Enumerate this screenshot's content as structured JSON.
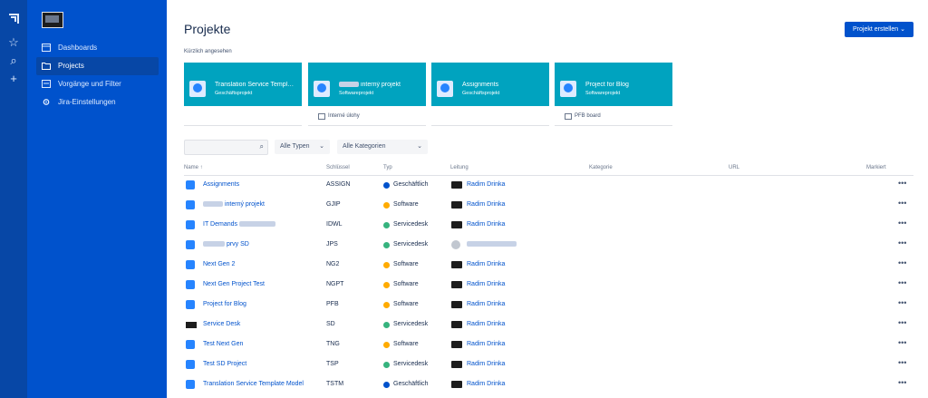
{
  "global_nav": {
    "icons": [
      "jira-logo-icon",
      "star-icon",
      "search-icon",
      "plus-icon"
    ]
  },
  "sidebar": {
    "items": [
      {
        "label": "Dashboards",
        "icon": "dashboard-icon"
      },
      {
        "label": "Projects",
        "icon": "folder-icon",
        "active": true
      },
      {
        "label": "Vorgänge und Filter",
        "icon": "issues-icon"
      },
      {
        "label": "Jira-Einstellungen",
        "icon": "gear-icon"
      }
    ]
  },
  "header": {
    "title": "Projekte",
    "create_button": "Projekt erstellen ⌄"
  },
  "recent": {
    "label": "Kürzlich angesehen",
    "cards": [
      {
        "title": "Translation Service Template Model",
        "subtitle": "Geschäftsprojekt",
        "bottom": ""
      },
      {
        "title": "interný projekt",
        "subtitle": "Softwareprojekt",
        "bottom": "Interné úlohy"
      },
      {
        "title": "Assignments",
        "subtitle": "Geschäftsprojekt",
        "bottom": ""
      },
      {
        "title": "Project for Blog",
        "subtitle": "Softwareprojekt",
        "bottom": "PFB board"
      }
    ]
  },
  "filters": {
    "search_placeholder": "",
    "types": "Alle Typen",
    "categories": "Alle Kategorien"
  },
  "table": {
    "headers": {
      "name": "Name ↑",
      "key": "Schlüssel",
      "type": "Typ",
      "lead": "Leitung",
      "category": "Kategorie",
      "url": "URL",
      "starred": "Markiert"
    },
    "rows": [
      {
        "name": "Assignments",
        "key": "ASSIGN",
        "type": "Geschäftlich",
        "lead": "Radim Drinka"
      },
      {
        "name": "interný projekt",
        "key": "GJIP",
        "type": "Software",
        "lead": "Radim Drinka"
      },
      {
        "name": "IT Demands",
        "key": "IDWL",
        "type": "Servicedesk",
        "lead": "Radim Drinka"
      },
      {
        "name": "prvy SD",
        "key": "JPS",
        "type": "Servicedesk",
        "lead": ""
      },
      {
        "name": "Next Gen 2",
        "key": "NG2",
        "type": "Software",
        "lead": "Radim Drinka"
      },
      {
        "name": "Next Gen Project Test",
        "key": "NGPT",
        "type": "Software",
        "lead": "Radim Drinka"
      },
      {
        "name": "Project for Blog",
        "key": "PFB",
        "type": "Software",
        "lead": "Radim Drinka"
      },
      {
        "name": "Service Desk",
        "key": "SD",
        "type": "Servicedesk",
        "lead": "Radim Drinka"
      },
      {
        "name": "Test Next Gen",
        "key": "TNG",
        "type": "Software",
        "lead": "Radim Drinka"
      },
      {
        "name": "Test SD Project",
        "key": "TSP",
        "type": "Servicedesk",
        "lead": "Radim Drinka"
      },
      {
        "name": "Translation Service Template Model",
        "key": "TSTM",
        "type": "Geschäftlich",
        "lead": "Radim Drinka"
      }
    ],
    "more_label": "•••"
  },
  "colors": {
    "sidebar": "#0052cc",
    "global_nav": "#0747a6",
    "card": "#00a3bf",
    "business": "#0052cc",
    "software": "#ffab00",
    "servicedesk": "#36b37e"
  }
}
